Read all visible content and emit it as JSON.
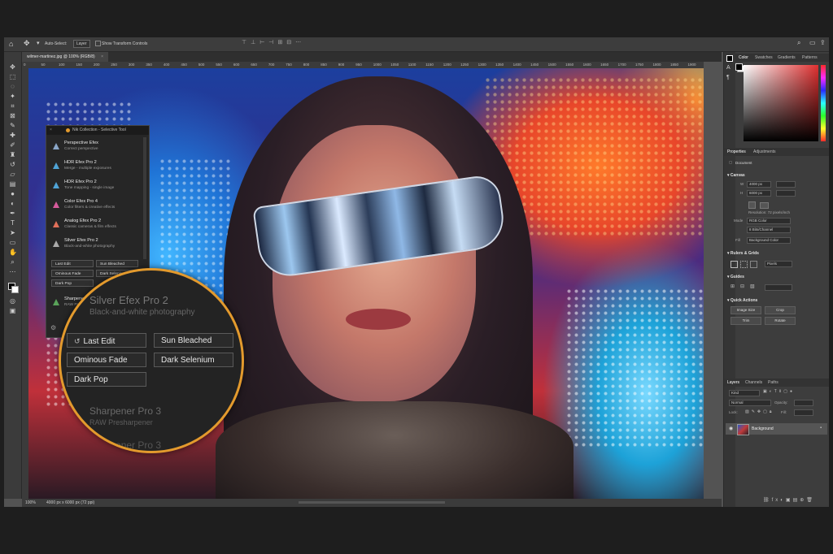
{
  "options_bar": {
    "auto_select_label": "Auto-Select:",
    "auto_select_value": "Layer",
    "show_transform_label": "Show Transform Controls"
  },
  "document_tab": {
    "title": "wilmer-martinez.jpg @ 100% (RGB/8)"
  },
  "ruler_ticks": [
    "0",
    "50",
    "100",
    "150",
    "200",
    "250",
    "300",
    "350",
    "400",
    "450",
    "500",
    "550",
    "600",
    "650",
    "700",
    "750",
    "800",
    "850",
    "900",
    "950",
    "1000",
    "1050",
    "1100",
    "1150",
    "1200",
    "1250",
    "1300",
    "1350",
    "1400",
    "1450",
    "1500",
    "1550",
    "1600",
    "1650",
    "1700",
    "1750",
    "1800",
    "1850",
    "1900"
  ],
  "status_bar": {
    "zoom": "100%",
    "doc_size": "4000 px x 6000 px (72 ppi)"
  },
  "nik_panel": {
    "title": "Nik Collection - Selective Tool",
    "items": [
      {
        "name": "Perspective Efex",
        "sub": "Correct perspective",
        "icon_color": "#8aa6c8"
      },
      {
        "name": "HDR Efex Pro 2",
        "sub": "Merge - multiple exposures",
        "icon_color": "#4fa3d6"
      },
      {
        "name": "HDR Efex Pro 2",
        "sub": "Tone mapping - single image",
        "icon_color": "#4fa3d6"
      },
      {
        "name": "Color Efex Pro 4",
        "sub": "Color filters & creative effects",
        "icon_color": "#d65a9c"
      },
      {
        "name": "Analog Efex Pro 2",
        "sub": "Classic cameras & film effects",
        "icon_color": "#e0705a"
      },
      {
        "name": "Silver Efex Pro 2",
        "sub": "Black-and-white photography",
        "icon_color": "#aaaaaa"
      }
    ],
    "presets": [
      "Last Edit",
      "Sun Bleached",
      "Ominous Fade",
      "Dark Selenium",
      "Dark Pop"
    ],
    "sharpener_partial": "Sharpener Pro 3",
    "sharpener_sub_partial": "RAW Presharpener"
  },
  "magnifier": {
    "title": "Silver Efex Pro 2",
    "subtitle": "Black-and-white photography",
    "presets": [
      "Last Edit",
      "Sun Bleached",
      "Ominous Fade",
      "Dark Selenium",
      "Dark Pop"
    ],
    "next_title": "Sharpener Pro 3",
    "next_sub": "RAW Presharpener",
    "cut_title": "Sharpener Pro 3",
    "accent": "#e39a2d"
  },
  "color_panel": {
    "tabs": [
      "Color",
      "Swatches",
      "Gradients",
      "Patterns"
    ]
  },
  "properties_panel": {
    "tabs": [
      "Properties",
      "Adjustments"
    ],
    "document_label": "Document",
    "canvas_label": "Canvas",
    "width": "4000 px",
    "height": "6000 px",
    "resolution": "Resolution: 72 pixels/inch",
    "mode_label": "Mode",
    "mode_value": "RGB Color",
    "depth_value": "8 Bits/Channel",
    "fill_label": "Fill",
    "fill_value": "Background Color",
    "rulers_label": "Rulers & Grids",
    "units_value": "Pixels",
    "guides_label": "Guides",
    "quick_actions_label": "Quick Actions",
    "actions": [
      "Image Size",
      "Crop",
      "Trim",
      "Rotate"
    ]
  },
  "layers_panel": {
    "tabs": [
      "Layers",
      "Channels",
      "Paths"
    ],
    "kind_placeholder": "Kind",
    "blend_value": "Normal",
    "opacity_label": "Opacity:",
    "fill_label": "Fill:",
    "lock_label": "Lock:",
    "layer_name": "Background"
  }
}
